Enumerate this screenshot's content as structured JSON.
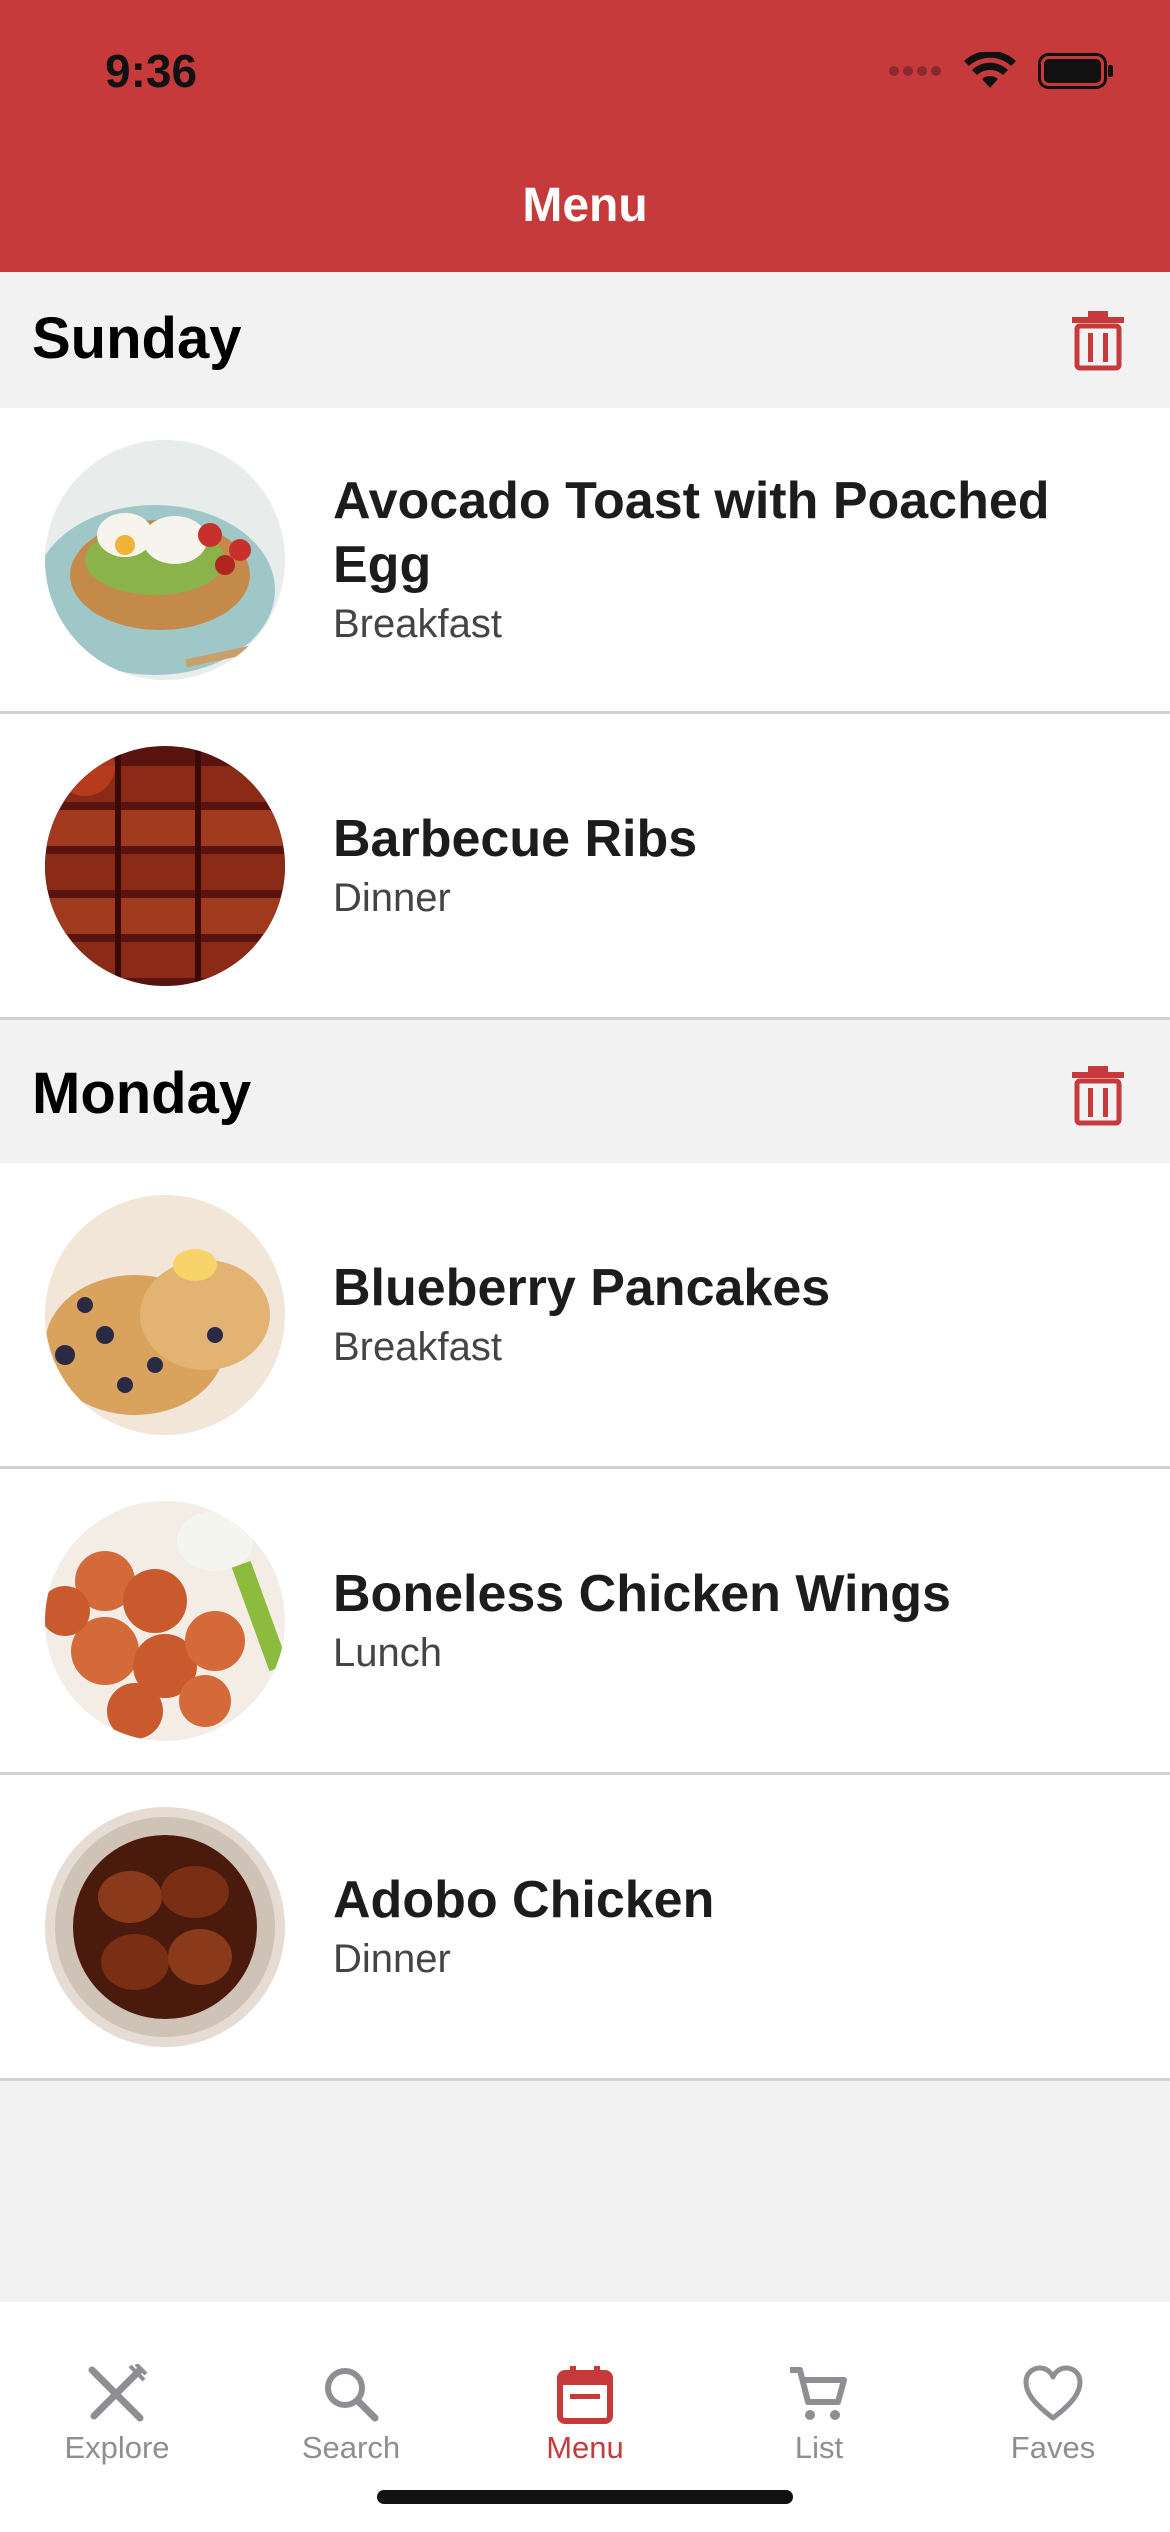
{
  "status": {
    "time": "9:36"
  },
  "nav": {
    "title": "Menu"
  },
  "colors": {
    "accent": "#c73a3c",
    "background": "#f2f2f2"
  },
  "sections": [
    {
      "day": "Sunday",
      "items": [
        {
          "title": "Avocado Toast with Poached Egg",
          "meal": "Breakfast",
          "image": "avocado-toast"
        },
        {
          "title": "Barbecue Ribs",
          "meal": "Dinner",
          "image": "barbecue-ribs"
        }
      ]
    },
    {
      "day": "Monday",
      "items": [
        {
          "title": "Blueberry Pancakes",
          "meal": "Breakfast",
          "image": "blueberry-pancakes"
        },
        {
          "title": "Boneless Chicken Wings",
          "meal": "Lunch",
          "image": "chicken-wings"
        },
        {
          "title": "Adobo Chicken",
          "meal": "Dinner",
          "image": "adobo-chicken"
        }
      ]
    }
  ],
  "tabs": [
    {
      "label": "Explore",
      "icon": "fork-knife-icon"
    },
    {
      "label": "Search",
      "icon": "search-icon"
    },
    {
      "label": "Menu",
      "icon": "calendar-icon",
      "active": true
    },
    {
      "label": "List",
      "icon": "cart-icon"
    },
    {
      "label": "Faves",
      "icon": "heart-icon"
    }
  ]
}
